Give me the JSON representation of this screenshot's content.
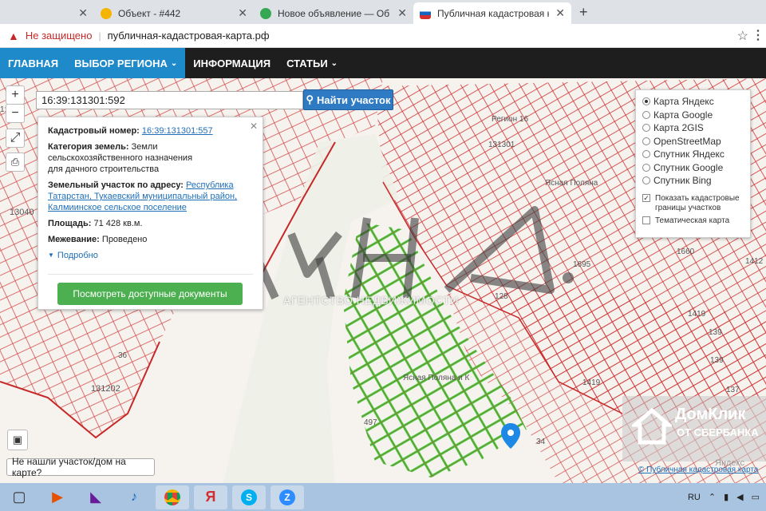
{
  "browser": {
    "tabs": [
      {
        "label": "",
        "color": "#4285f4"
      },
      {
        "label": "Объект - #442",
        "color": "#f4b400"
      },
      {
        "label": "Новое объявление — Объявле",
        "color": "#34a853"
      },
      {
        "label": "Публичная кадастровая карта Р",
        "color": "#d32f2f"
      }
    ],
    "new_tab": "+",
    "security_label": "Не защищено",
    "url": "публичная-кадастровая-карта.рф"
  },
  "nav": {
    "items": [
      {
        "label": "ГЛАВНАЯ",
        "blue": true
      },
      {
        "label": "ВЫБОР РЕГИОНА",
        "blue": true,
        "caret": true
      },
      {
        "label": "ИНФОРМАЦИЯ",
        "blue": false
      },
      {
        "label": "СТАТЬИ",
        "blue": false,
        "caret": true
      }
    ]
  },
  "map": {
    "search_value": "16:39:131301:592",
    "find_button": "Найти участок",
    "zoom_in": "+",
    "zoom_out": "−",
    "labels": {
      "region16": "Регион 16",
      "block131301": "131301",
      "block131202": "131202",
      "yasnaya": "Ясная Поляна",
      "yasnaya_k": "Ясная Поляна и К",
      "n13040": "13040",
      "n1419a": "1419",
      "n1419b": "1419",
      "n139a": "139",
      "n139b": "139",
      "n137": "137",
      "n34": "34",
      "n36": "36",
      "n128": "128",
      "n1695": "1695",
      "n1660": "1660",
      "n1412": "1412",
      "n1401": "1:01",
      "n497": "497"
    },
    "info": {
      "cad_label": "Кадастровый номер:",
      "cad_value": "16:39:131301:557",
      "cat_label": "Категория земель:",
      "cat_value": "Земли сельскохозяйственного назначения",
      "cat_value2": "для дачного строительства",
      "addr_label": "Земельный участок по адресу:",
      "addr_value": "Республика Татарстан, Тукаевский муниципальный район, Калмиинское сельское поселение",
      "area_label": "Площадь:",
      "area_value": "71 428 кв.м.",
      "border_label": "Межевание:",
      "border_value": "Проведено",
      "more": "Подробно",
      "docs_button": "Посмотреть доступные документы"
    },
    "layers": [
      {
        "label": "Карта Яндекс",
        "selected": true
      },
      {
        "label": "Карта Google",
        "selected": false
      },
      {
        "label": "Карта 2GIS",
        "selected": false
      },
      {
        "label": "OpenStreetMap",
        "selected": false
      },
      {
        "label": "Спутник Яндекс",
        "selected": false
      },
      {
        "label": "Спутник Google",
        "selected": false
      },
      {
        "label": "Спутник Bing",
        "selected": false
      }
    ],
    "show_borders": "Показать кадастровые границы участков",
    "thematic": "Тематическая карта",
    "not_found": "Не нашли участок/дом на карте?",
    "watermark_sub": "АГЕНТСТВО НЕДВИЖИМОСТИ",
    "watermark_logo": "ЛУНА",
    "domklik_title": "ДомКлик",
    "domklik_sub": "ОТ СБЕРБАНКА",
    "attribution": "© Публичная кадастровая карта",
    "yandex_mark": "Яндекс"
  },
  "taskbar": {
    "lang": "RU"
  },
  "colors": {
    "accent": "#1f8ac9",
    "parcel_line": "#c62828",
    "highlight": "#4caf50"
  }
}
